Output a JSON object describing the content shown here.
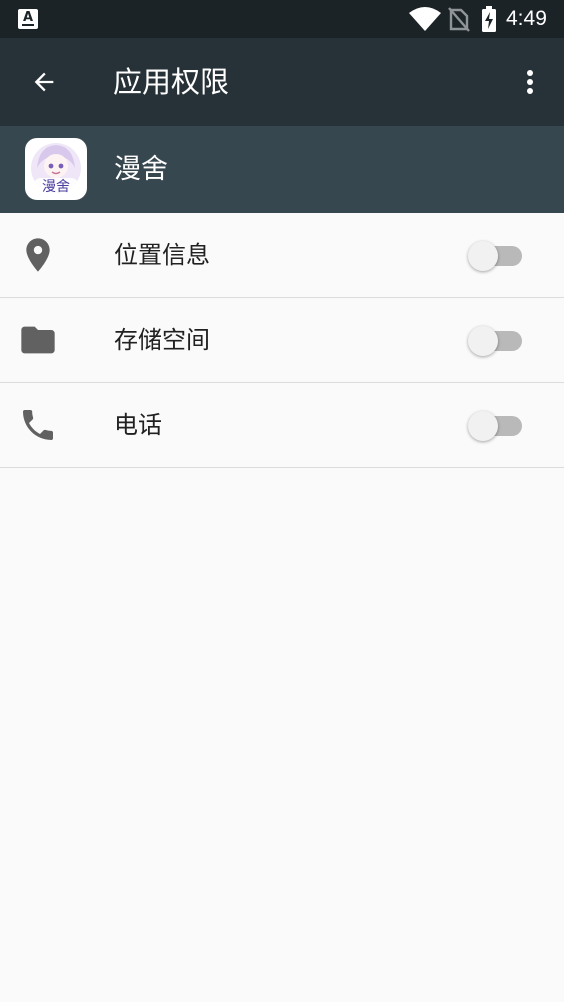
{
  "status_bar": {
    "time": "4:49",
    "icons": [
      "text-notification-icon",
      "wifi-icon",
      "no-sim-icon",
      "battery-charging-icon"
    ]
  },
  "app_bar": {
    "title": "应用权限",
    "icons": [
      "back-arrow-icon",
      "more-vert-icon"
    ],
    "background": "#263238"
  },
  "app_header": {
    "app_name": "漫舍",
    "logo_text": "漫舍",
    "background": "#37474f"
  },
  "permissions": [
    {
      "label": "位置信息",
      "icon": "location-pin-icon",
      "enabled": false
    },
    {
      "label": "存储空间",
      "icon": "folder-icon",
      "enabled": false
    },
    {
      "label": "电话",
      "icon": "phone-icon",
      "enabled": false
    }
  ]
}
